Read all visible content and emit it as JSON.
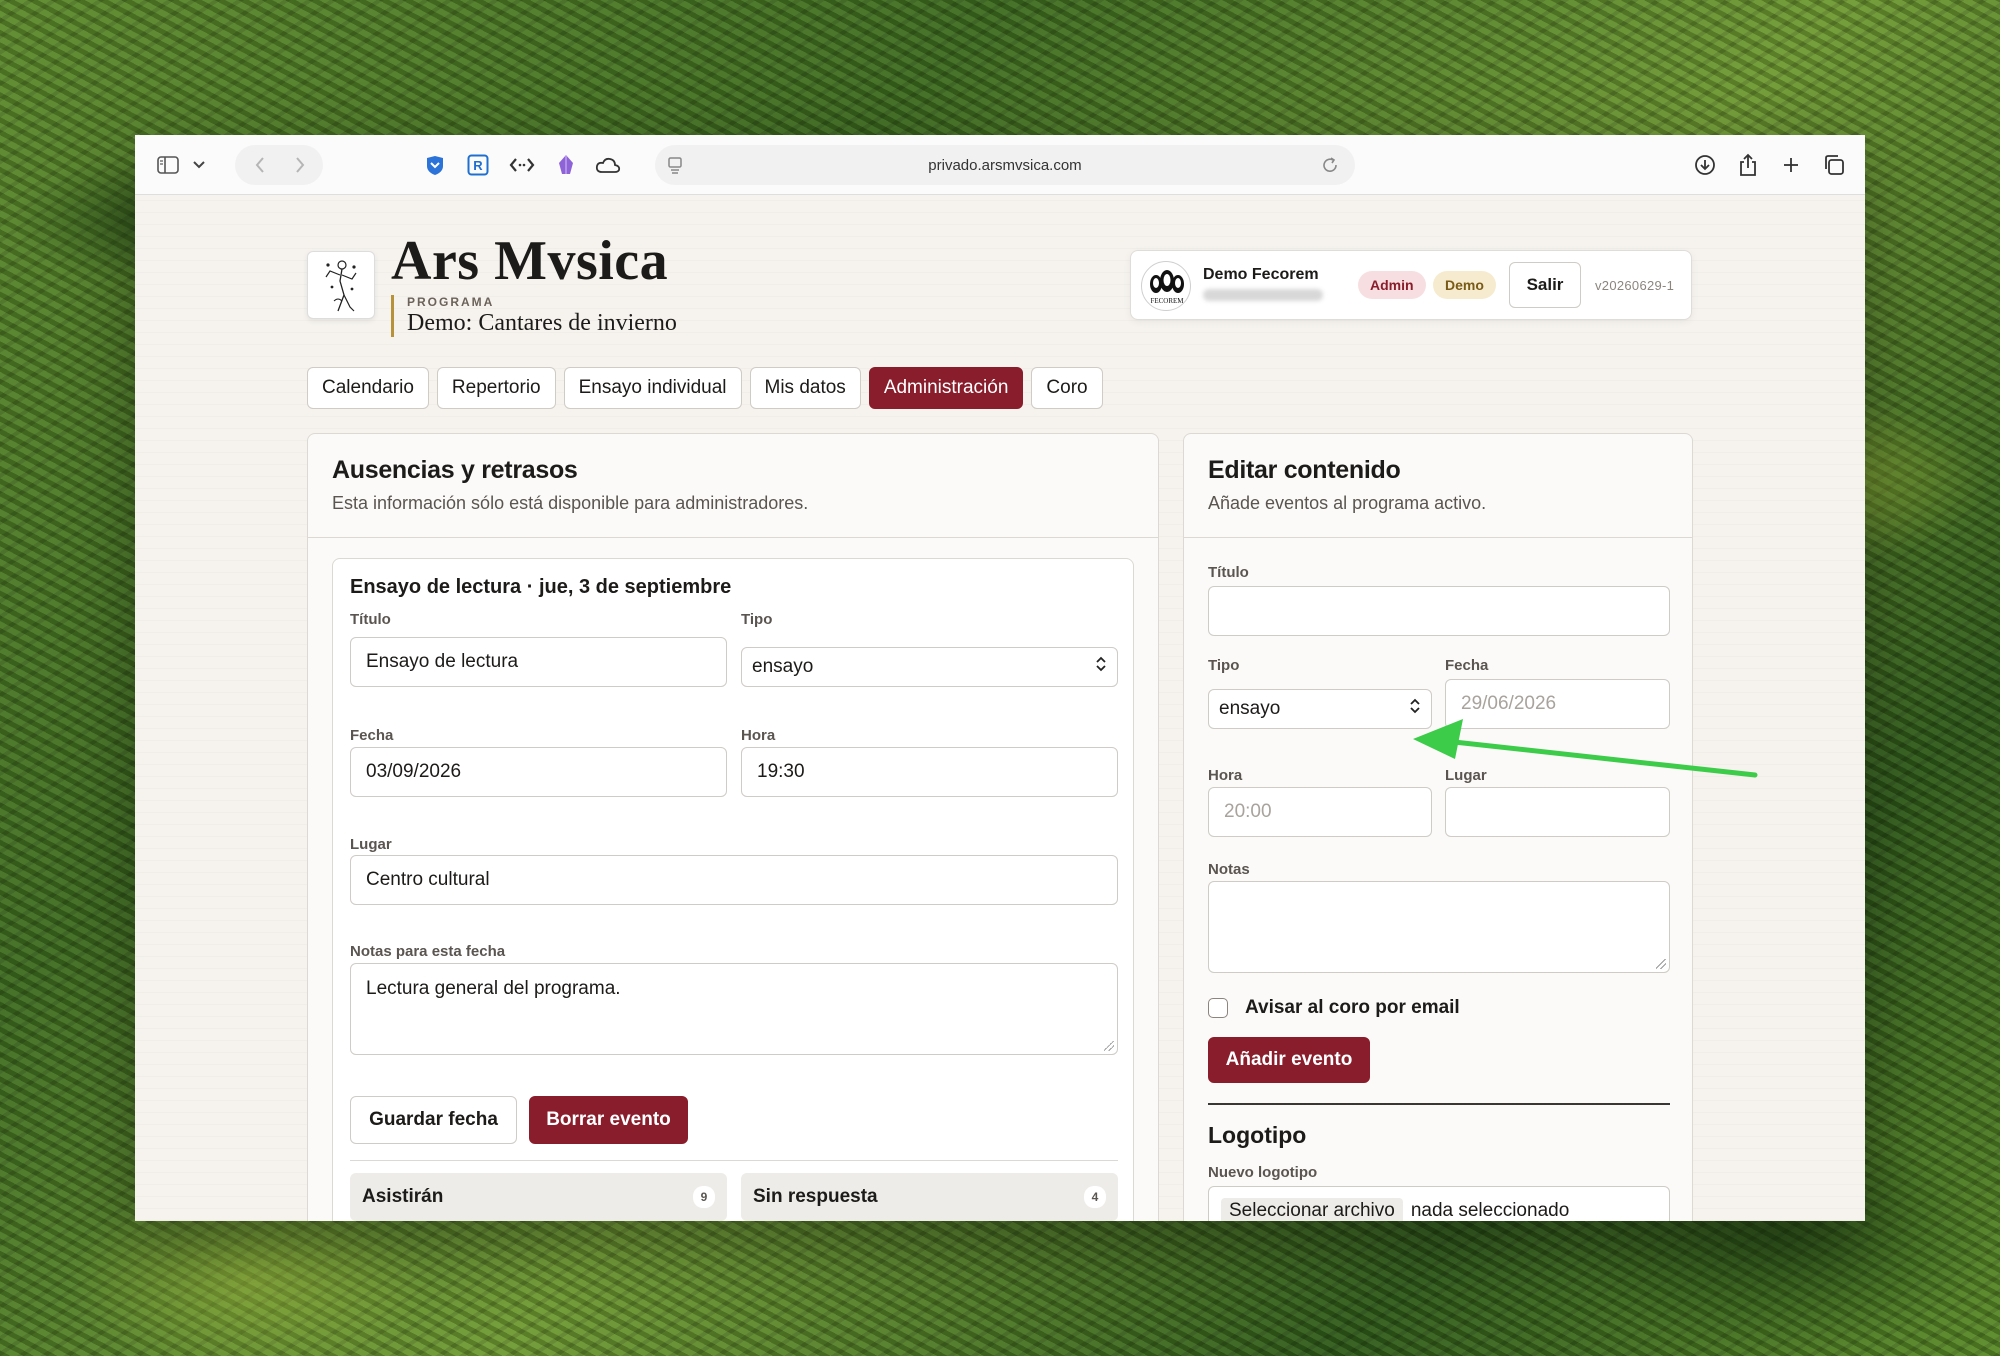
{
  "browser": {
    "url": "privado.arsmvsica.com"
  },
  "brand": {
    "title": "Ars Mvsica",
    "program_label": "PROGRAMA",
    "program_name": "Demo: Cantares de invierno"
  },
  "user": {
    "name": "Demo Fecorem",
    "avatar_text": "FECOREM",
    "badge_admin": "Admin",
    "badge_demo": "Demo",
    "logout_label": "Salir",
    "version": "v20260629-1"
  },
  "nav": {
    "tabs": [
      {
        "label": "Calendario"
      },
      {
        "label": "Repertorio"
      },
      {
        "label": "Ensayo individual"
      },
      {
        "label": "Mis datos"
      },
      {
        "label": "Administración"
      },
      {
        "label": "Coro"
      }
    ],
    "active": "Administración"
  },
  "absences": {
    "title": "Ausencias y retrasos",
    "subtitle": "Esta información sólo está disponible para administradores.",
    "event": {
      "heading": "Ensayo de lectura · jue, 3 de septiembre",
      "title_label": "Título",
      "title_value": "Ensayo de lectura",
      "type_label": "Tipo",
      "type_value": "ensayo",
      "date_label": "Fecha",
      "date_value": "03/09/2026",
      "time_label": "Hora",
      "time_value": "19:30",
      "place_label": "Lugar",
      "place_value": "Centro cultural",
      "notes_label": "Notas para esta fecha",
      "notes_value": "Lectura general del programa.",
      "save_label": "Guardar fecha",
      "delete_label": "Borrar evento"
    },
    "stats": [
      {
        "label": "Asistirán",
        "count": "9"
      },
      {
        "label": "Sin respuesta",
        "count": "4"
      }
    ]
  },
  "edit": {
    "title": "Editar contenido",
    "subtitle": "Añade eventos al programa activo.",
    "title_label": "Título",
    "title_value": "",
    "type_label": "Tipo",
    "type_value": "ensayo",
    "date_label": "Fecha",
    "date_placeholder": "29/06/2026",
    "time_label": "Hora",
    "time_placeholder": "20:00",
    "place_label": "Lugar",
    "place_value": "",
    "notes_label": "Notas",
    "notify_label": "Avisar al coro por email",
    "notify_checked": false,
    "add_label": "Añadir evento",
    "logo_title": "Logotipo",
    "logo_label": "Nuevo logotipo",
    "file_button": "Seleccionar archivo",
    "file_status": "nada seleccionado"
  },
  "annotation": {
    "arrow_color": "#3ccc4a"
  },
  "colors": {
    "accent": "#8a1d2b",
    "program_bar": "#b8923b"
  }
}
